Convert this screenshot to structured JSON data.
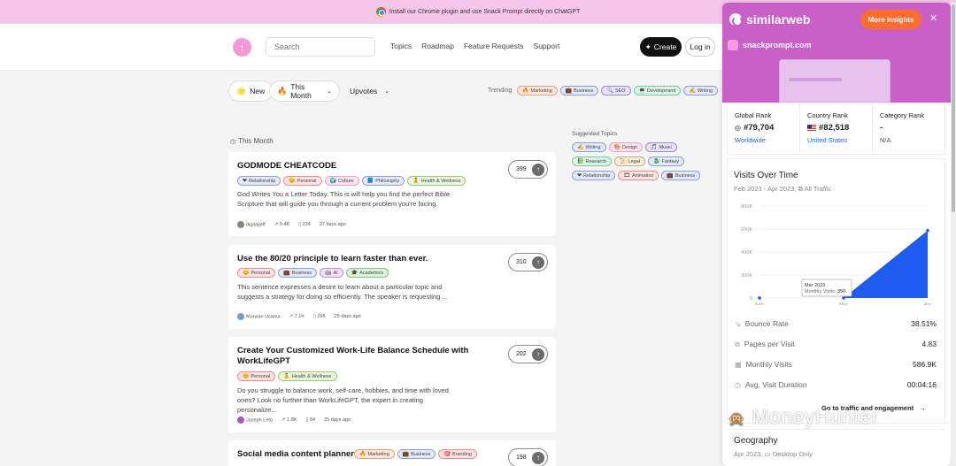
{
  "banner": {
    "text": "Install our Chrome plugin and use Snack Prompt directly on ChatGPT"
  },
  "header": {
    "search_placeholder": "Search",
    "nav": [
      "Topics",
      "Roadmap",
      "Feature Requests",
      "Support"
    ],
    "create_label": "Create",
    "login_label": "Log in"
  },
  "filters": {
    "new": "New",
    "this_month": "This Month",
    "upvotes": "Upvotes",
    "trending_label": "Trending"
  },
  "trending": [
    {
      "icon": "🔥",
      "label": "Marketing",
      "color": "#f0a07a",
      "bg": "#fde7dc"
    },
    {
      "icon": "💼",
      "label": "Business",
      "color": "#8aa0d8",
      "bg": "#e3e9fa"
    },
    {
      "icon": "🔍",
      "label": "SEO",
      "color": "#9c8ad8",
      "bg": "#e9e3fa"
    },
    {
      "icon": "💻",
      "label": "Development",
      "color": "#7ac9a0",
      "bg": "#dcf4e7"
    },
    {
      "icon": "✍",
      "label": "Writing",
      "color": "#8aa0d8",
      "bg": "#e3e9fa"
    }
  ],
  "section_label": "This Month",
  "cards": [
    {
      "title": "GODMODE CHEATCODE",
      "tags": [
        {
          "icon": "❤",
          "label": "Relationship",
          "color": "#8aa0d8",
          "bg": "#e3e9fa"
        },
        {
          "icon": "😊",
          "label": "Personal",
          "color": "#f08a8a",
          "bg": "#fde3e3"
        },
        {
          "icon": "🌍",
          "label": "Culture",
          "color": "#f0a0c8",
          "bg": "#fde3f0"
        },
        {
          "icon": "📘",
          "label": "Philosophy",
          "color": "#8aa0d8",
          "bg": "#e3e9fa"
        },
        {
          "icon": "🧘",
          "label": "Health & Wellness",
          "color": "#9ac87a",
          "bg": "#eaf6dc"
        }
      ],
      "desc": "God Writes You a Letter Today. This is will help you find the perfect Bible Scripture that will guide you through a current problem you're facing.",
      "author": "digitaljeff",
      "views": "9.4K",
      "saves": "224",
      "ago": "27 days ago",
      "votes": "399"
    },
    {
      "title": "Use the 80/20 principle to learn faster than ever.",
      "tags": [
        {
          "icon": "😊",
          "label": "Personal",
          "color": "#f08a8a",
          "bg": "#fde3e3"
        },
        {
          "icon": "💼",
          "label": "Business",
          "color": "#8aa0d8",
          "bg": "#e3e9fa"
        },
        {
          "icon": "🤖",
          "label": "AI",
          "color": "#c88ad8",
          "bg": "#f3e3fa"
        },
        {
          "icon": "🎓",
          "label": "Academics",
          "color": "#7ac97a",
          "bg": "#dcf4dc"
        }
      ],
      "desc": "This sentence expresses a desire to learn about a particular topic and suggests a strategy for doing so efficiently. The speaker is requesting ...",
      "author": "Marwan Usama",
      "views": "7.1K",
      "saves": "295",
      "ago": "25 days ago",
      "votes": "310"
    },
    {
      "title": "Create Your Customized Work-Life Balance Schedule with WorkLifeGPT",
      "tags": [
        {
          "icon": "😊",
          "label": "Personal",
          "color": "#f08a8a",
          "bg": "#fde3e3"
        },
        {
          "icon": "🧘",
          "label": "Health & Wellness",
          "color": "#9ac87a",
          "bg": "#eaf6dc"
        }
      ],
      "desc": "Do you struggle to balance work, self-care, hobbies, and time with loved ones? Look no further than WorkLifeGPT, the expert in creating personalize...",
      "author": "Joseph Leto",
      "views": "1.8K",
      "saves": "84",
      "ago": "25 days ago",
      "votes": "202"
    },
    {
      "title": "Social media content planner",
      "tags": [
        {
          "icon": "🔥",
          "label": "Marketing",
          "color": "#f0a07a",
          "bg": "#fde7dc"
        },
        {
          "icon": "💼",
          "label": "Business",
          "color": "#8aa0d8",
          "bg": "#e3e9fa"
        },
        {
          "icon": "🎯",
          "label": "Branding",
          "color": "#f08a8a",
          "bg": "#fde3e3"
        }
      ],
      "votes": "198"
    }
  ],
  "suggested": {
    "label": "Suggested Topics",
    "rows": [
      [
        {
          "icon": "✍",
          "label": "Writing",
          "color": "#8aa0d8",
          "bg": "#e3e9fa"
        },
        {
          "icon": "🎨",
          "label": "Design",
          "color": "#f0a0c8",
          "bg": "#fde3f0"
        },
        {
          "icon": "🎵",
          "label": "Music",
          "color": "#9c8ad8",
          "bg": "#e9e3fa"
        }
      ],
      [
        {
          "icon": "📗",
          "label": "Research",
          "color": "#7ac9a0",
          "bg": "#dcf4e7"
        },
        {
          "icon": "📜",
          "label": "Legal",
          "color": "#c8b07a",
          "bg": "#f6efdc"
        },
        {
          "icon": "🐉",
          "label": "Fantasy",
          "color": "#8aa0d8",
          "bg": "#e3e9fa"
        }
      ],
      [
        {
          "icon": "❤",
          "label": "Relationship",
          "color": "#8aa0d8",
          "bg": "#e3e9fa"
        },
        {
          "icon": "🎞",
          "label": "Animation",
          "color": "#f08a8a",
          "bg": "#fde3e3"
        },
        {
          "icon": "💼",
          "label": "Business",
          "color": "#8aa0d8",
          "bg": "#e3e9fa"
        }
      ]
    ]
  },
  "similarweb": {
    "brand": "similarweb",
    "more_label": "More insights",
    "domain": "snackprompt.com",
    "ranks": [
      {
        "label": "Global Rank",
        "value": "#79,704",
        "sub": "Worldwide"
      },
      {
        "label": "Country Rank",
        "value": "#82,518",
        "sub": "United States"
      },
      {
        "label": "Category Rank",
        "value": "-",
        "sub": "N/A"
      }
    ],
    "visits_title": "Visits Over Time",
    "visits_sub": "Feb 2023 - Apr 2023,",
    "visits_scope": "All Traffic",
    "tooltip": {
      "month": "Mar 2023",
      "label": "Monthly Visits:",
      "value": "350"
    },
    "metrics": [
      {
        "icon": "↘",
        "label": "Bounce Rate",
        "value": "38.51%"
      },
      {
        "icon": "⧉",
        "label": "Pages per Visit",
        "value": "4.83"
      },
      {
        "icon": "▦",
        "label": "Monthly Visits",
        "value": "586.9K"
      },
      {
        "icon": "◷",
        "label": "Avg. Visit Duration",
        "value": "00:04:16"
      }
    ],
    "traffic_link": "Go to traffic and engagement",
    "geo_title": "Geography",
    "geo_sub": "Apr 2023,",
    "geo_scope": "Desktop Only"
  },
  "chart_data": {
    "type": "area",
    "x": [
      "Feb",
      "Mar",
      "Apr"
    ],
    "series": [
      {
        "values": [
          350,
          350,
          586900
        ]
      }
    ],
    "y_ticks": [
      "0",
      "200K",
      "400K",
      "600K",
      "800K"
    ],
    "ylim": [
      0,
      800000
    ],
    "accent": "#1e5cf0"
  },
  "watermark": "MoneyHunter"
}
